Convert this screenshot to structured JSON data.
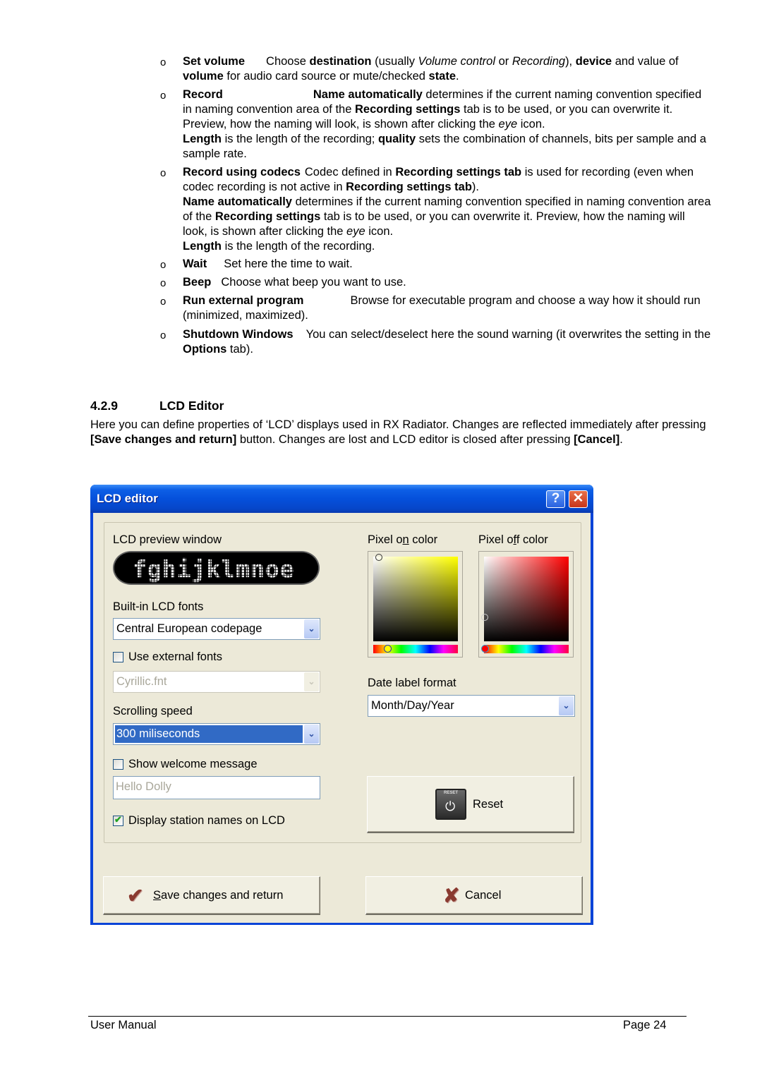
{
  "items": [
    {
      "term": "Set volume",
      "parts": [
        {
          "t": "Choose "
        },
        {
          "b": "destination"
        },
        {
          "t": " (usually "
        },
        {
          "i": "Volume control"
        },
        {
          "t": " or "
        },
        {
          "i": "Recording"
        },
        {
          "t": "), "
        },
        {
          "b": "device"
        },
        {
          "t": " and value of "
        },
        {
          "b": "volume"
        },
        {
          "t": " for audio card source or mute/checked "
        },
        {
          "b": "state"
        },
        {
          "t": "."
        }
      ]
    },
    {
      "term": "Record",
      "parts": [
        {
          "b": "Name automatically"
        },
        {
          "t": "  determines if the current naming convention specified in naming convention area of the "
        },
        {
          "b": "Recording settings"
        },
        {
          "t": " tab is to be used, or you can overwrite it. Preview, how the naming will look, is shown after clicking the "
        },
        {
          "i": "eye"
        },
        {
          "t": " icon."
        },
        {
          "br": true
        },
        {
          "b": "Length"
        },
        {
          "t": " is the length of the recording; "
        },
        {
          "b": "quality"
        },
        {
          "t": " sets the combination of channels, bits per sample and a sample rate."
        }
      ]
    },
    {
      "term": "Record using codecs",
      "parts": [
        {
          "t": "Codec defined in "
        },
        {
          "b": "Recording settings tab"
        },
        {
          "t": " is used for recording (even when codec recording is not active in "
        },
        {
          "b": "Recording settings tab"
        },
        {
          "t": ")."
        },
        {
          "br": true
        },
        {
          "b": "Name automatically"
        },
        {
          "t": "  determines if the current naming convention specified in naming convention area of the "
        },
        {
          "b": "Recording settings"
        },
        {
          "t": " tab is to be used, or you can overwrite it. Preview, how the naming will look, is shown after clicking the "
        },
        {
          "i": "eye"
        },
        {
          "t": " icon."
        },
        {
          "br": true
        },
        {
          "b": "Length"
        },
        {
          "t": " is the length of the recording."
        }
      ]
    },
    {
      "term": "Wait",
      "parts": [
        {
          "t": "Set here the time to wait."
        }
      ]
    },
    {
      "term": "Beep",
      "parts": [
        {
          "t": "Choose what beep you want to use."
        }
      ]
    },
    {
      "term": "Run external program",
      "parts": [
        {
          "t": "Browse for executable program and choose a way how it should run (minimized, maximized)."
        }
      ]
    },
    {
      "term": "Shutdown Windows",
      "parts": [
        {
          "t": "You can select/deselect here the sound warning (it overwrites the setting in the "
        },
        {
          "b": "Options"
        },
        {
          "t": " tab)."
        }
      ]
    }
  ],
  "bullet_glyph": "o",
  "section": {
    "number": "4.2.9",
    "title": "LCD Editor",
    "intro_parts": [
      {
        "t": "Here you can define properties of ‘LCD’ displays used in RX Radiator. Changes are reflected immediately after pressing "
      },
      {
        "b": "[Save changes and return]"
      },
      {
        "t": " button. Changes are lost and LCD editor is closed after pressing "
      },
      {
        "b": "[Cancel]"
      },
      {
        "t": "."
      }
    ]
  },
  "dialog": {
    "title": "LCD editor",
    "help_glyph": "?",
    "close_glyph": "✕",
    "lcd_preview_label": "LCD preview window",
    "lcd_preview_text": "fghijklmnoe",
    "builtin_fonts_label": "Built-in LCD fonts",
    "builtin_fonts_value": "Central European codepage",
    "use_external_fonts_label": "Use external fonts",
    "use_external_fonts_checked": false,
    "external_font_value": "Cyrillic.fnt",
    "scrolling_speed_label": "Scrolling speed",
    "scrolling_speed_value": "300 miliseconds",
    "show_welcome_label": "Show welcome message",
    "show_welcome_checked": false,
    "welcome_message_value": "Hello Dolly",
    "display_station_names_label": "Display station names on LCD",
    "display_station_names_checked": true,
    "pixel_on_label_pre": "Pixel o",
    "pixel_on_label_u": "n",
    "pixel_on_label_post": " color",
    "pixel_on_color": "#ffff00",
    "pixel_off_label_pre": "Pixel o",
    "pixel_off_label_u": "f",
    "pixel_off_label_post": "f color",
    "pixel_off_color": "#ff0000",
    "date_format_label": "Date label format",
    "date_format_value": "Month/Day/Year",
    "reset_label": "Reset",
    "reset_icon_caption": "RESET",
    "save_label_u": "S",
    "save_label_rest": "ave changes and return",
    "cancel_label": "Cancel",
    "dropdown_arrow": "⌄",
    "check_glyph": "✔"
  },
  "footer": {
    "left": "User Manual",
    "right": "Page 24"
  }
}
